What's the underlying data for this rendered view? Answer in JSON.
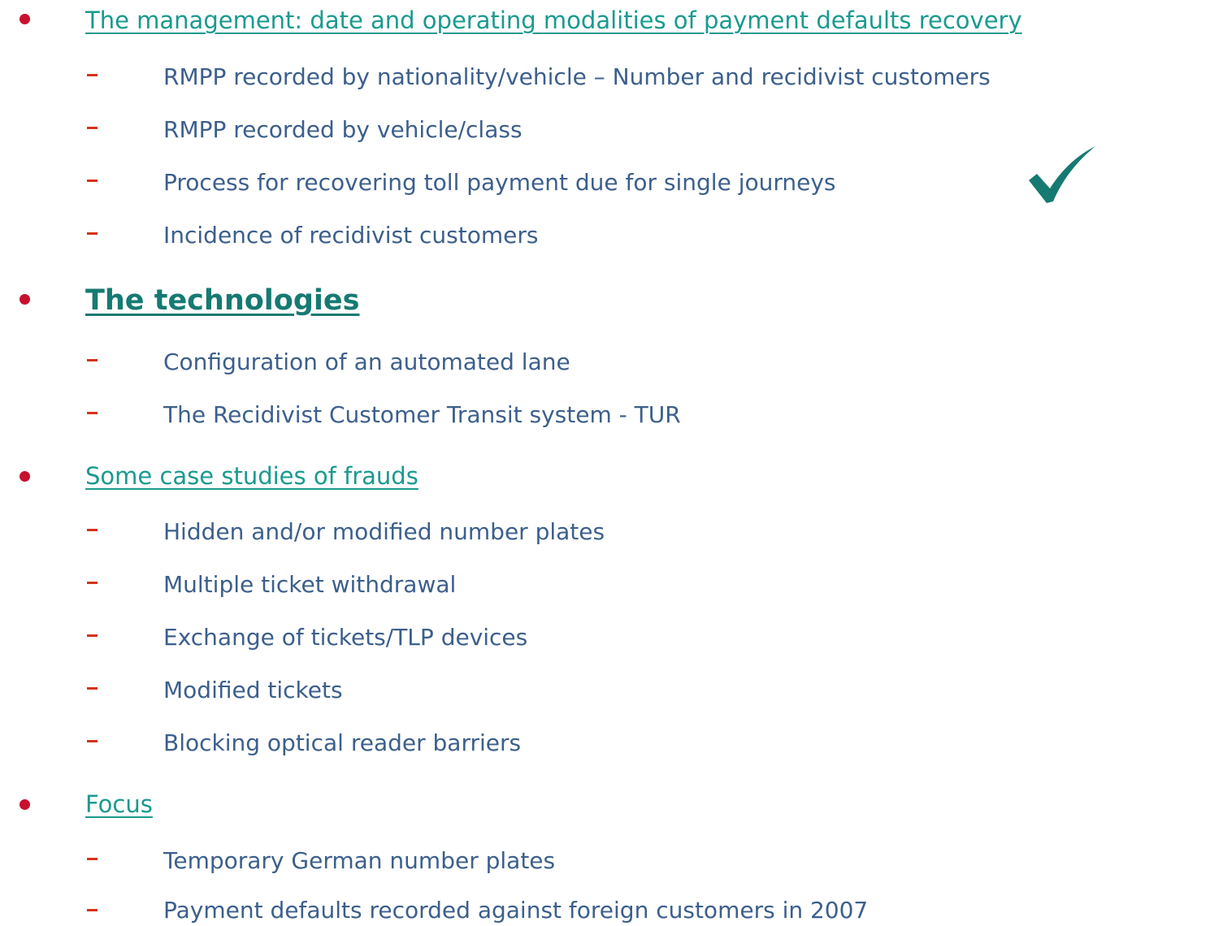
{
  "sections": [
    {
      "title": "The management: date and operating modalities of payment defaults recovery",
      "items": [
        "RMPP recorded by nationality/vehicle – Number and recidivist customers",
        "RMPP recorded by vehicle/class",
        "Process for recovering toll payment due for single journeys",
        "Incidence of recidivist customers"
      ]
    },
    {
      "title": "The technologies",
      "items": [
        "Configuration of an automated lane",
        "The Recidivist Customer Transit system - TUR"
      ]
    },
    {
      "title": "Some case studies of frauds",
      "items": [
        "Hidden and/or modified number plates",
        "Multiple ticket withdrawal",
        "Exchange of tickets/TLP devices",
        "Modified tickets",
        "Blocking optical reader barriers"
      ]
    },
    {
      "title": "Focus",
      "items": [
        "Temporary German number plates",
        "Payment defaults recorded against foreign customers in 2007"
      ]
    }
  ],
  "colors": {
    "bullet": "#c8102e",
    "dash": "#d4331a",
    "heading": "#1a9a8f",
    "heading_active": "#167a72",
    "item_text": "#3c5f8c",
    "check": "#167a72"
  },
  "checkmark": {
    "icon": "checkmark-icon",
    "marks_item": "Process for recovering toll payment due for single journeys"
  }
}
